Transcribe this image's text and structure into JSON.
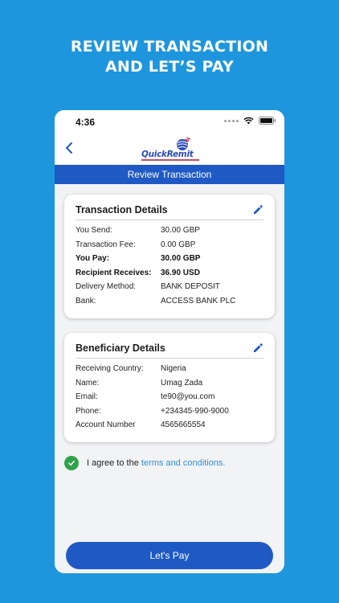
{
  "headline": {
    "line1": "REVIEW TRANSACTION",
    "line2": "AND LET’S PAY"
  },
  "status_bar": {
    "time": "4:36"
  },
  "app_bar": {
    "logo_text_quick": "Quick",
    "logo_text_remit": "Remit",
    "back_icon": "chevron-left-icon"
  },
  "title_bar": {
    "title": "Review Transaction"
  },
  "transaction_details": {
    "title": "Transaction Details",
    "rows": [
      {
        "label": "You Send:",
        "value": "30.00 GBP"
      },
      {
        "label": "Transaction Fee:",
        "value": "0.00 GBP"
      },
      {
        "label": "You Pay:",
        "value": "30.00 GBP"
      },
      {
        "label": "Recipient Receives:",
        "value": "36.90 USD"
      },
      {
        "label": "Delivery Method:",
        "value": "BANK DEPOSIT"
      },
      {
        "label": "Bank:",
        "value": "ACCESS BANK PLC"
      }
    ]
  },
  "beneficiary_details": {
    "title": "Beneficiary Details",
    "rows": [
      {
        "label": "Receiving Country:",
        "value": "Nigeria"
      },
      {
        "label": "Name:",
        "value": "Umag Zada"
      },
      {
        "label": "Email:",
        "value": "te90@you.com"
      },
      {
        "label": "Phone:",
        "value": "+234345-990-9000"
      },
      {
        "label": "Account Number",
        "value": "4565665554"
      }
    ]
  },
  "agreement": {
    "prefix": "I agree to the",
    "link": "terms and conditions.",
    "checked": true
  },
  "pay_button": {
    "label": "Let's Pay"
  },
  "colors": {
    "background": "#1e96de",
    "primary": "#1e59c4",
    "check": "#2fa34a",
    "link": "#2f8fd6"
  }
}
